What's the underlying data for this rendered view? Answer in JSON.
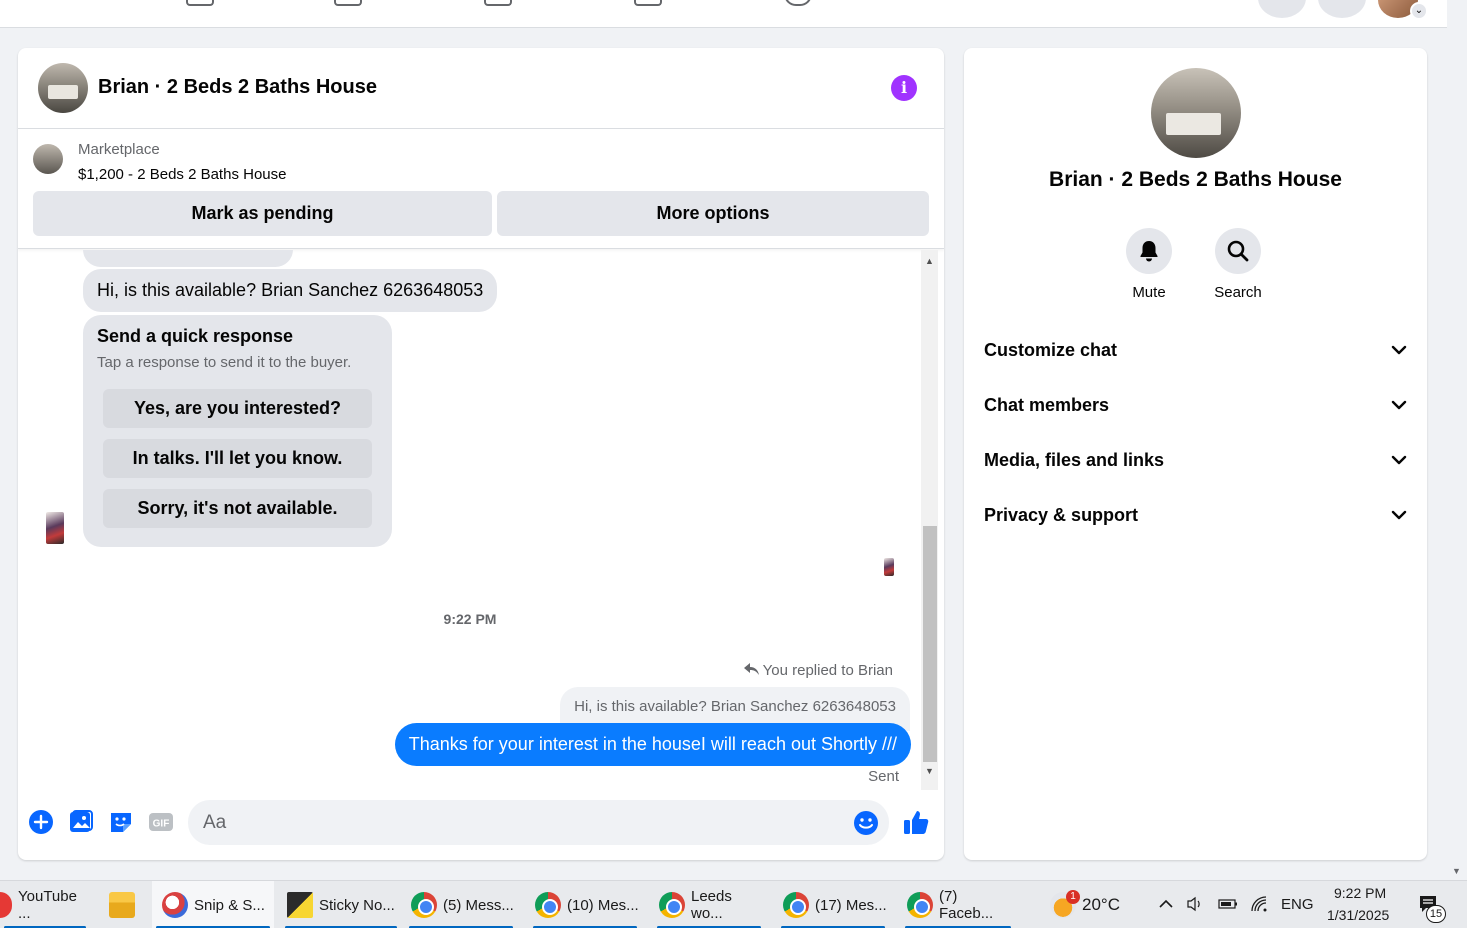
{
  "chat": {
    "title": "Brian · 2 Beds 2 Baths House",
    "marketplace_label": "Marketplace",
    "listing": "$1,200 - 2 Beds 2 Baths House",
    "mark_pending": "Mark as pending",
    "more_options": "More options",
    "messages": {
      "incoming": "Hi, is this available? Brian Sanchez 6263648053",
      "quick_title": "Send a quick response",
      "quick_sub": "Tap a response to send it to the buyer.",
      "quick_options": [
        "Yes, are you interested?",
        "In talks. I'll let you know.",
        "Sorry, it's not available."
      ],
      "timestamp": "9:22 PM",
      "replied_to": "You replied to Brian",
      "quoted": "Hi, is this available? Brian Sanchez 6263648053",
      "outgoing": "Thanks for your interest in the houseI will reach out Shortly ///",
      "status": "Sent"
    },
    "composer_placeholder": "Aa"
  },
  "info": {
    "title": "Brian · 2 Beds 2 Baths House",
    "mute": "Mute",
    "search": "Search",
    "sections": [
      "Customize chat",
      "Chat members",
      "Media, files and links",
      "Privacy & support"
    ]
  },
  "taskbar": {
    "items": [
      "YouTube ...",
      "Snip & S...",
      "Sticky No...",
      "(5) Mess...",
      "(10) Mes...",
      "Leeds wo...",
      "(17) Mes...",
      "(7) Faceb..."
    ],
    "weather_badge": "1",
    "temperature": "20°C",
    "language": "ENG",
    "time": "9:22 PM",
    "date": "1/31/2025",
    "notifications": "15"
  },
  "colors": {
    "accent": "#0866ff",
    "bubble_out": "#0a7cff",
    "info_purple": "#a033ff"
  }
}
